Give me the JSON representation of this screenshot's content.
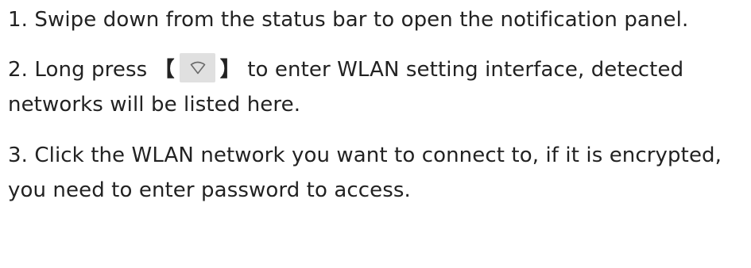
{
  "steps": [
    {
      "text": "1. Swipe down from the status bar to open the notification panel."
    },
    {
      "before": "2. Long press",
      "open_bracket": "【",
      "icon": "wifi-icon",
      "close_bracket": "】",
      "after": "to enter WLAN setting interface, detected networks will be listed here."
    },
    {
      "text": "3. Click the WLAN network you want to connect to, if it is encrypted, you need to enter password to access."
    }
  ],
  "colors": {
    "text": "#222222",
    "icon_background": "#e0e0e0",
    "icon_stroke": "#6b6b6b"
  }
}
